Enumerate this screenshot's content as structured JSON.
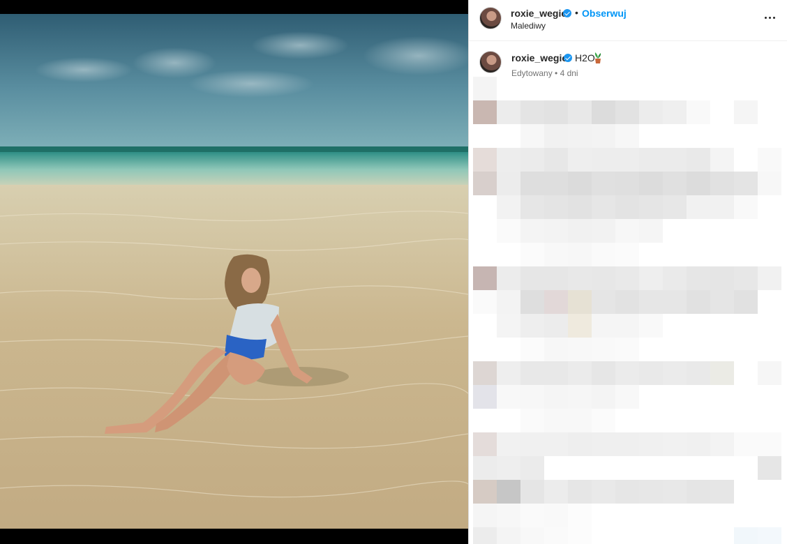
{
  "post": {
    "author": {
      "username": "roxie_wegiel",
      "verified": true
    },
    "follow_label": "Obserwuj",
    "separator": "•",
    "location": "Malediwy",
    "caption": {
      "username": "roxie_wegiel",
      "text": "H2O",
      "emoji_icon": "potted-plant-icon"
    },
    "meta": "Edytowany • 4 dni",
    "more_icon": "more-options-icon"
  },
  "colors": {
    "follow_accent": "#0095f6",
    "verified_badge": "#1c96f0",
    "text_primary": "#262626",
    "text_secondary": "#737373"
  }
}
